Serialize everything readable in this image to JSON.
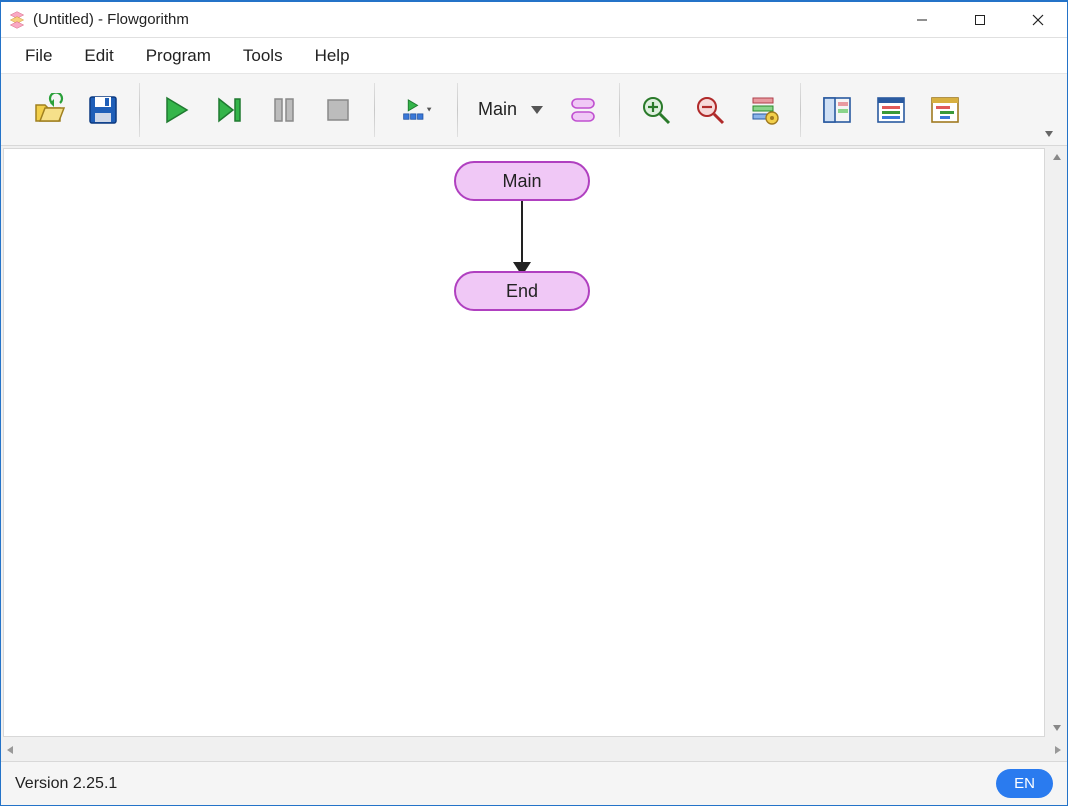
{
  "window": {
    "title": "(Untitled) - Flowgorithm"
  },
  "menu": {
    "items": [
      "File",
      "Edit",
      "Program",
      "Tools",
      "Help"
    ]
  },
  "toolbar": {
    "function_selector": "Main"
  },
  "flowchart": {
    "start_label": "Main",
    "end_label": "End"
  },
  "status": {
    "version": "Version 2.25.1",
    "language": "EN"
  }
}
